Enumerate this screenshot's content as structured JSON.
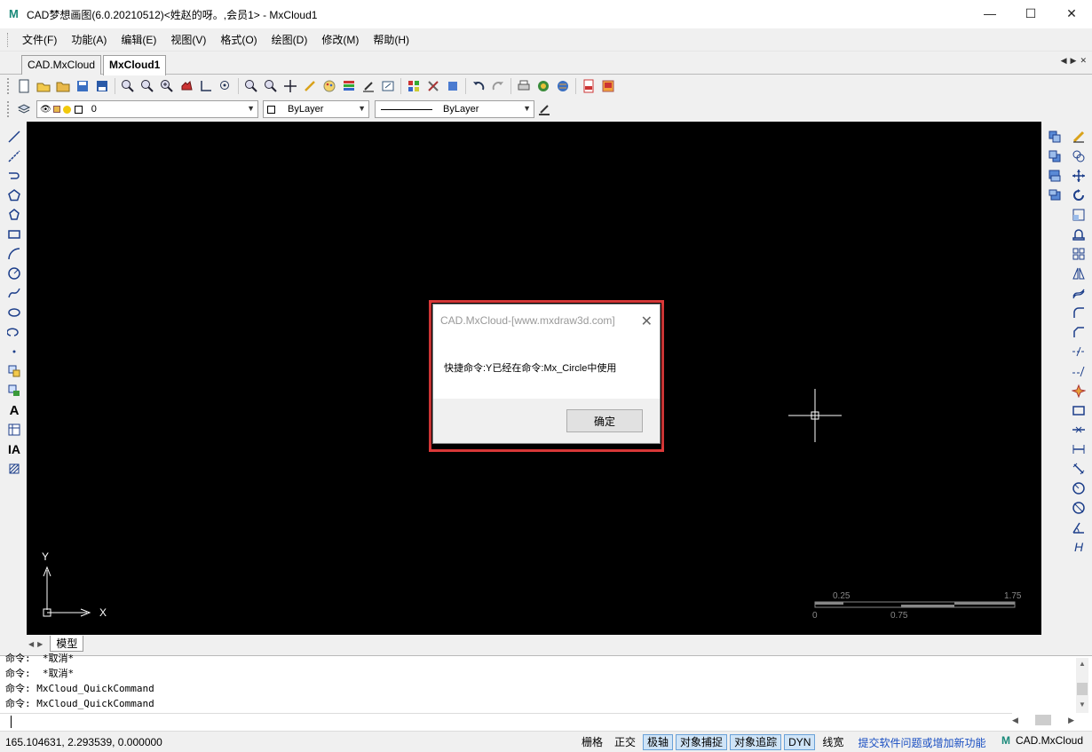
{
  "window": {
    "title": "CAD梦想画图(6.0.20210512)<姓赵的呀。,会员1> - MxCloud1",
    "minimize": "—",
    "maximize": "☐",
    "close": "✕"
  },
  "menu": [
    {
      "label": "文件(F)"
    },
    {
      "label": "功能(A)"
    },
    {
      "label": "编辑(E)"
    },
    {
      "label": "视图(V)"
    },
    {
      "label": "格式(O)"
    },
    {
      "label": "绘图(D)"
    },
    {
      "label": "修改(M)"
    },
    {
      "label": "帮助(H)"
    }
  ],
  "tabs": [
    {
      "label": "CAD.MxCloud",
      "active": false
    },
    {
      "label": "MxCloud1",
      "active": true
    }
  ],
  "properties": {
    "layer": "0",
    "color": "ByLayer",
    "linetype": "ByLayer"
  },
  "canvas": {
    "axis_y": "Y",
    "axis_x": "X",
    "scale_labels": [
      "0.25",
      "1.75",
      "0",
      "0.75"
    ]
  },
  "dialog": {
    "title": "CAD.MxCloud-[www.mxdraw3d.com]",
    "message": "快捷命令:Y已经在命令:Mx_Circle中使用",
    "ok_label": "确定"
  },
  "model_tab": "模型",
  "command_lines": [
    "命令:  *取消*",
    "命令:  *取消*",
    "命令: MxCloud_QuickCommand",
    "命令: MxCloud_QuickCommand"
  ],
  "status": {
    "coordinates": "165.104631,  2.293539,  0.000000",
    "toggles": [
      {
        "label": "栅格",
        "on": false
      },
      {
        "label": "正交",
        "on": false
      },
      {
        "label": "极轴",
        "on": true
      },
      {
        "label": "对象捕捉",
        "on": true
      },
      {
        "label": "对象追踪",
        "on": true
      },
      {
        "label": "DYN",
        "on": true
      },
      {
        "label": "线宽",
        "on": false
      }
    ],
    "feedback_link": "提交软件问题或增加新功能",
    "brand": "CAD.MxCloud"
  },
  "colors": {
    "canvas_bg": "#000000",
    "highlight": "#e03a3a",
    "toggle_on": "#cfe4f7",
    "link": "#1a4fc2"
  }
}
